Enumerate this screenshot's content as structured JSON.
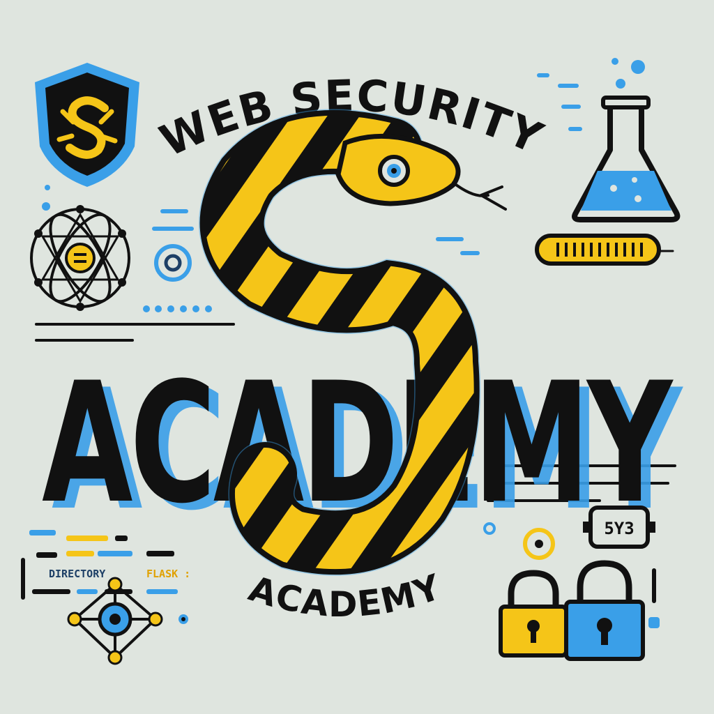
{
  "logo": {
    "top_arc_text": "WEB SECURITY",
    "main_title": "ACADEMY",
    "bottom_arc_text": "ACADEMY"
  },
  "code_snippet": {
    "word_1": "DIRECTORY",
    "word_2": "FLASK :"
  },
  "badge": {
    "text": "5Y3"
  },
  "colors": {
    "background": "#dfe5df",
    "black": "#111111",
    "yellow": "#f5c518",
    "blue": "#3a9fe8",
    "dark_blue": "#1d3f66"
  },
  "icons": [
    "shield-icon",
    "python-snake-icon",
    "flask-icon",
    "thermometer-icon",
    "atom-icon",
    "network-node-icon",
    "padlock-yellow-icon",
    "padlock-blue-icon",
    "target-ring-icon"
  ]
}
